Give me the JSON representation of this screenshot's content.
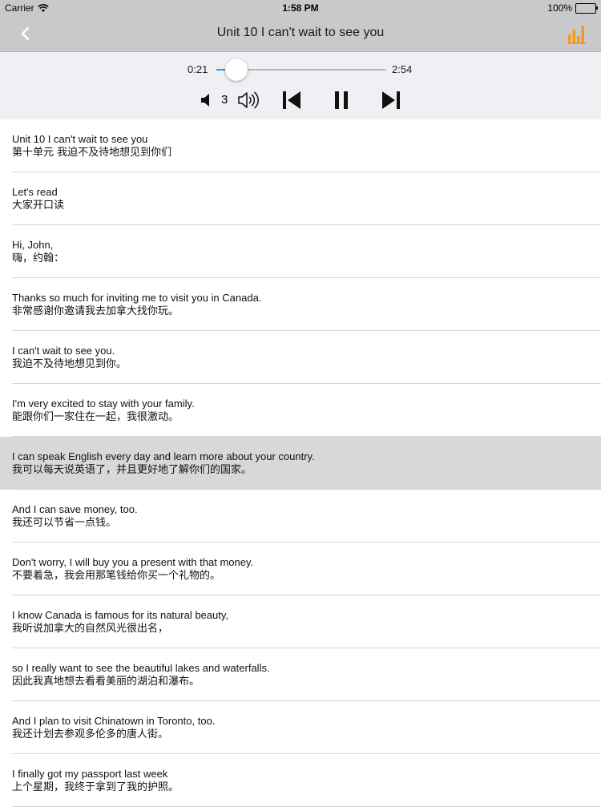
{
  "status_bar": {
    "carrier": "Carrier",
    "time": "1:58 PM",
    "battery": "100%"
  },
  "nav": {
    "title": "Unit 10 I can't wait to see you",
    "back_icon": "chevron-left-icon",
    "equalizer_icon": "equalizer-icon",
    "accent_color": "#f39a1e"
  },
  "player": {
    "elapsed": "0:21",
    "duration": "2:54",
    "progress": 0.12,
    "volume": "3",
    "slider_color": "#1c9be6"
  },
  "sentences": [
    {
      "en": "Unit 10 I can't wait to see you",
      "zh": "第十单元 我迫不及待地想见到你们",
      "highlighted": false
    },
    {
      "en": "Let's read",
      "zh": "大家开口读",
      "highlighted": false
    },
    {
      "en": "Hi, John,",
      "zh": "嗨，约翰：",
      "highlighted": false
    },
    {
      "en": "Thanks so much for inviting me to visit you in Canada.",
      "zh": "非常感谢你邀请我去加拿大找你玩。",
      "highlighted": false
    },
    {
      "en": "I can't wait to see you.",
      "zh": "我迫不及待地想见到你。",
      "highlighted": false
    },
    {
      "en": "I'm very excited to stay with your family.",
      "zh": "能跟你们一家住在一起，我很激动。",
      "highlighted": false
    },
    {
      "en": "I can speak English every day and learn more about your country.",
      "zh": "我可以每天说英语了，并且更好地了解你们的国家。",
      "highlighted": true
    },
    {
      "en": "And I can save money, too.",
      "zh": "我还可以节省一点钱。",
      "highlighted": false
    },
    {
      "en": "Don't worry, I will buy you a present with that money.",
      "zh": "不要着急，我会用那笔钱给你买一个礼物的。",
      "highlighted": false
    },
    {
      "en": "I know Canada is famous for its natural beauty,",
      "zh": "我听说加拿大的自然风光很出名，",
      "highlighted": false
    },
    {
      "en": "so I really want to see the beautiful lakes and waterfalls.",
      "zh": "因此我真地想去看看美丽的湖泊和瀑布。",
      "highlighted": false
    },
    {
      "en": "And I plan to visit Chinatown in Toronto, too.",
      "zh": "我还计划去参观多伦多的唐人街。",
      "highlighted": false
    },
    {
      "en": "I finally got my passport last week",
      "zh": "上个星期，我终于拿到了我的护照。",
      "highlighted": false
    }
  ]
}
